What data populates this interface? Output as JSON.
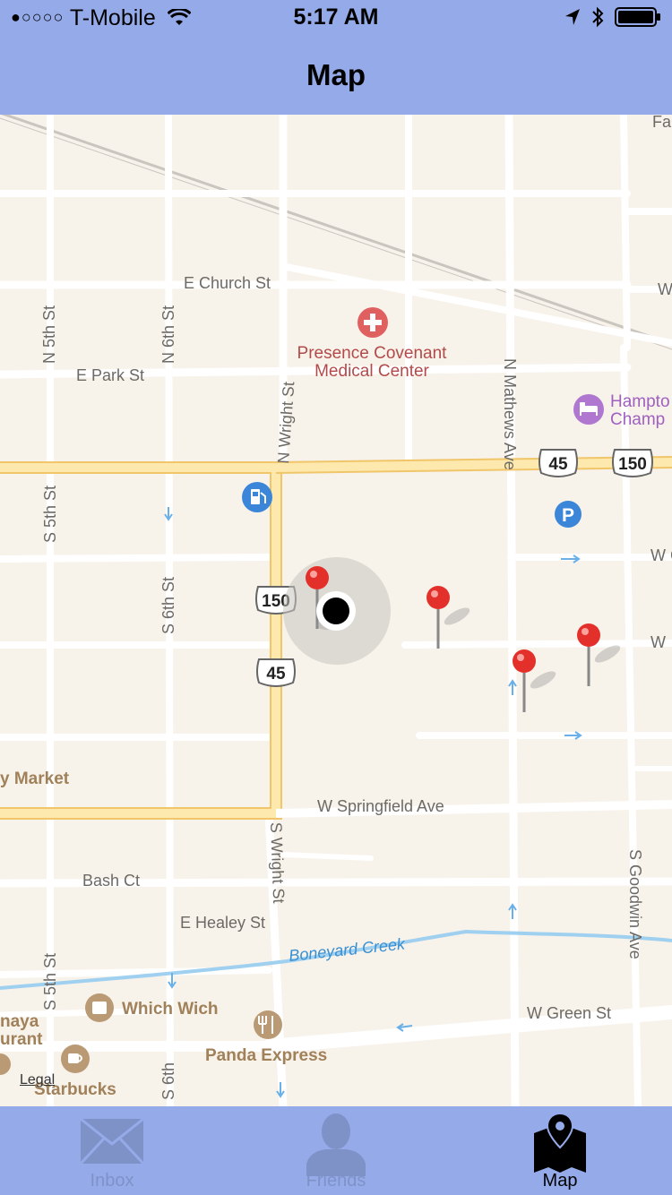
{
  "status_bar": {
    "signal": "●○○○○",
    "carrier": "T-Mobile",
    "time": "5:17 AM",
    "icons": [
      "wifi-icon",
      "location-arrow-icon",
      "bluetooth-icon",
      "battery-icon"
    ]
  },
  "nav": {
    "title": "Map"
  },
  "map": {
    "streets": {
      "e_church": "E Church St",
      "e_park": "E Park St",
      "n_5th": "N 5th St",
      "n_6th": "N 6th St",
      "n_wright": "N Wright St",
      "n_mathews": "N Mathews Ave",
      "s_5th": "S 5th St",
      "s_6th": "S 6th St",
      "s_wright": "S Wright St",
      "s_goodwin": "S Goodwin Ave",
      "w_springfield": "W Springfield Ave",
      "bash_ct": "Bash Ct",
      "e_healey": "E Healey St",
      "w_green": "W Green St",
      "s_5th_lower": "S 5th St",
      "s_6th_lower": "S 6th",
      "fai_partial": "Fai",
      "w_partial_1": "W",
      "w_partial_2": "W C",
      "w_partial_3": "W"
    },
    "water": {
      "creek": "Boneyard Creek"
    },
    "pois": {
      "hospital_line1": "Presence Covenant",
      "hospital_line2": "Medical Center",
      "hotel_line1": "Hampto",
      "hotel_line2": "Champ",
      "market": "y Market",
      "which_wich": "Which Wich",
      "panda": "Panda Express",
      "starbucks": "Starbucks",
      "naya_line1": "naya",
      "naya_line2": "urant"
    },
    "shields": {
      "us150_top": "150",
      "us45_top": "45",
      "us150_mid": "150",
      "us45_mid": "45"
    },
    "pins_count": 4,
    "legal": "Legal",
    "colors": {
      "land": "#f7f2ea",
      "street": "#ffffff",
      "highway": "#fce7a8",
      "pin": "#e4302a",
      "water": "#9fd0f0"
    }
  },
  "tabs": [
    {
      "label": "Inbox",
      "icon": "envelope-icon",
      "active": false
    },
    {
      "label": "Friends",
      "icon": "person-icon",
      "active": false
    },
    {
      "label": "Map",
      "icon": "map-pin-icon",
      "active": true
    }
  ]
}
